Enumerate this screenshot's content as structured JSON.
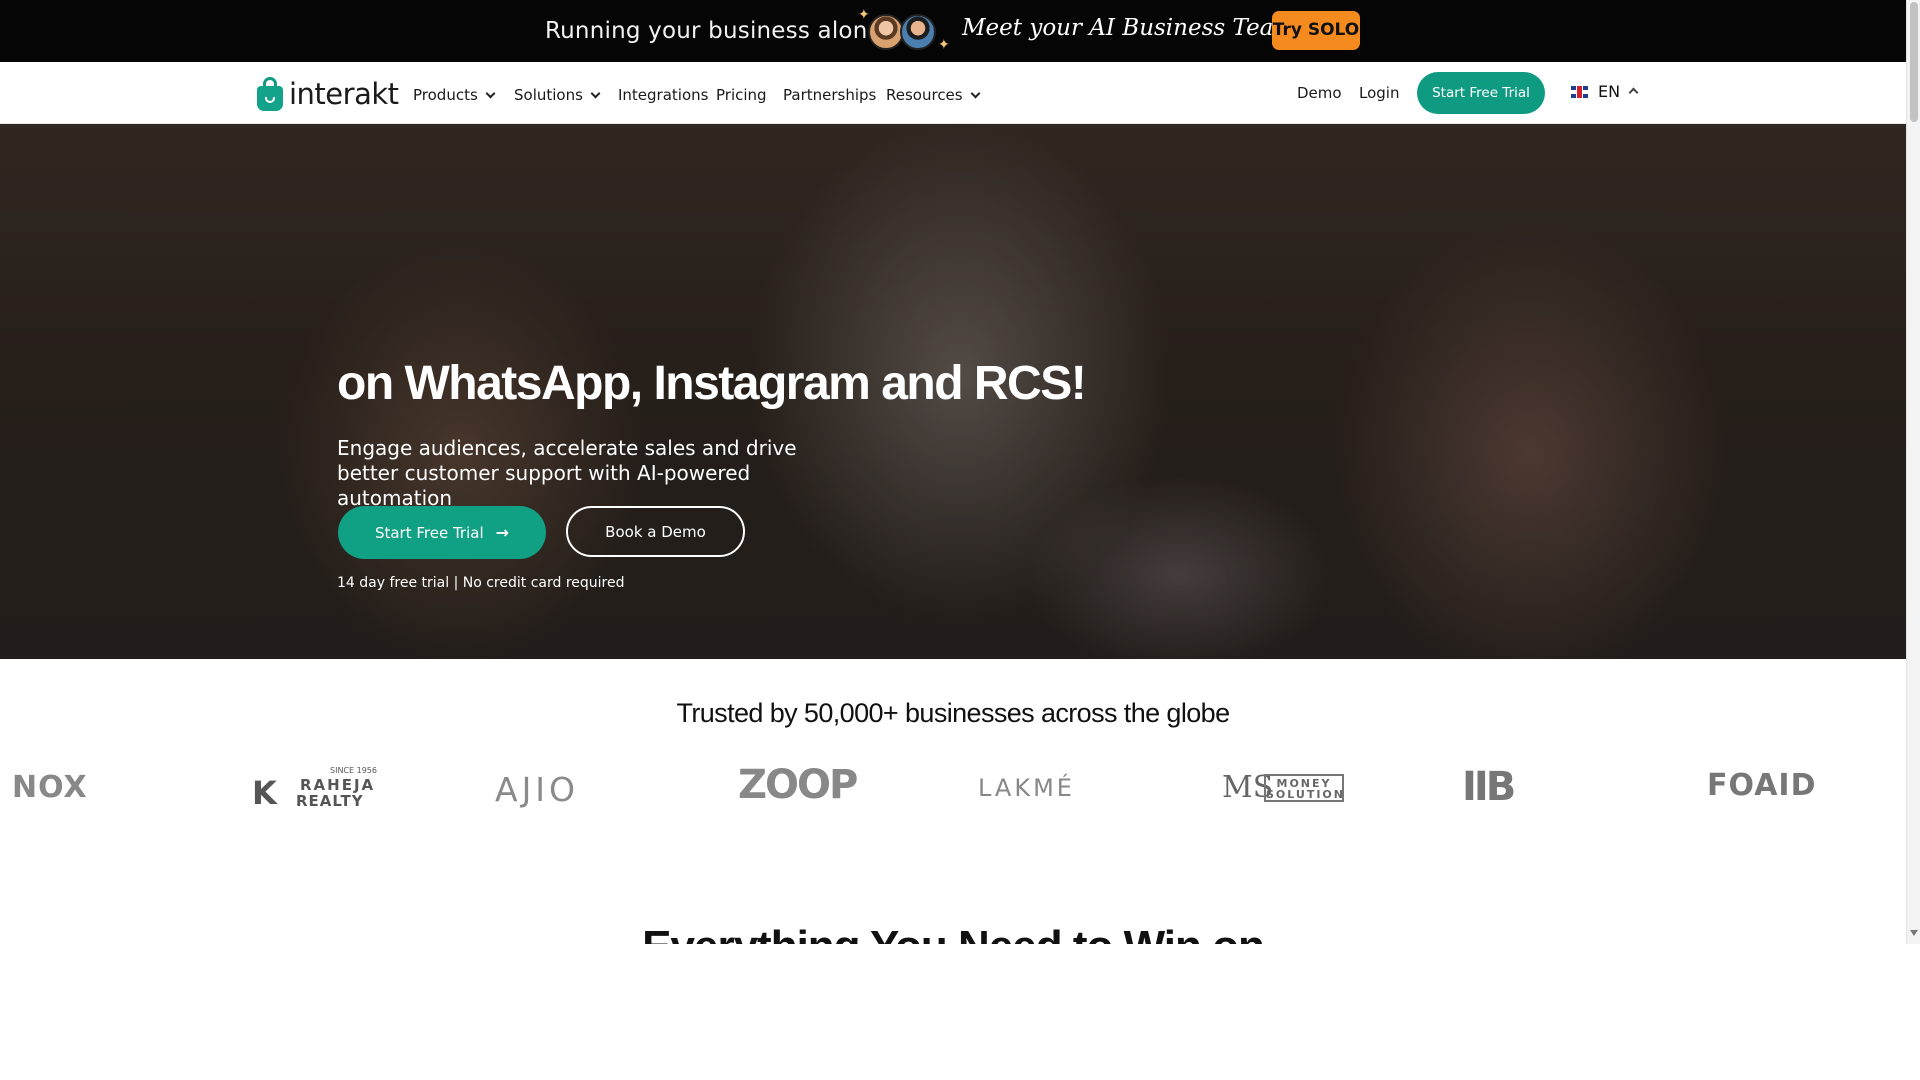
{
  "promo": {
    "question": "Running your business alone?",
    "headline": "Meet your AI Business Team.",
    "cta": "Try SOLO"
  },
  "nav": {
    "logo_text": "interakt",
    "items": [
      {
        "label": "Products"
      },
      {
        "label": "Solutions"
      },
      {
        "label": "Integrations"
      },
      {
        "label": "Pricing"
      },
      {
        "label": "Partnerships"
      },
      {
        "label": "Resources"
      }
    ],
    "demo": "Demo",
    "login": "Login",
    "cta": "Start Free Trial",
    "language": "EN"
  },
  "hero": {
    "headline": "on WhatsApp, Instagram and RCS!",
    "subheadline": "Engage audiences, accelerate sales and drive better customer support with AI-powered automation",
    "primary_cta": "Start Free Trial",
    "secondary_cta": "Book a Demo",
    "note": "14 day free trial | No credit card required"
  },
  "trusted": {
    "title": "Trusted by 50,000+ businesses across the globe",
    "brands": {
      "nox": "NOX",
      "raheja_since": "SINCE 1956",
      "raheja_line1": "RAHEJA",
      "raheja_line2": "REALTY",
      "ajio": "AJIO",
      "zoop": "ZOOP",
      "lakme": "LAKMÉ",
      "money_ms": "MS",
      "money_line1": "MONEY",
      "money_line2": "SOLUTION",
      "iib": "IIB",
      "foaid": "FOAID"
    }
  },
  "next_section": {
    "heading": "Everything You Need to Win on"
  },
  "colors": {
    "brand_green": "#10a083",
    "promo_orange": "#f58a1f",
    "promo_bg": "#050505"
  }
}
